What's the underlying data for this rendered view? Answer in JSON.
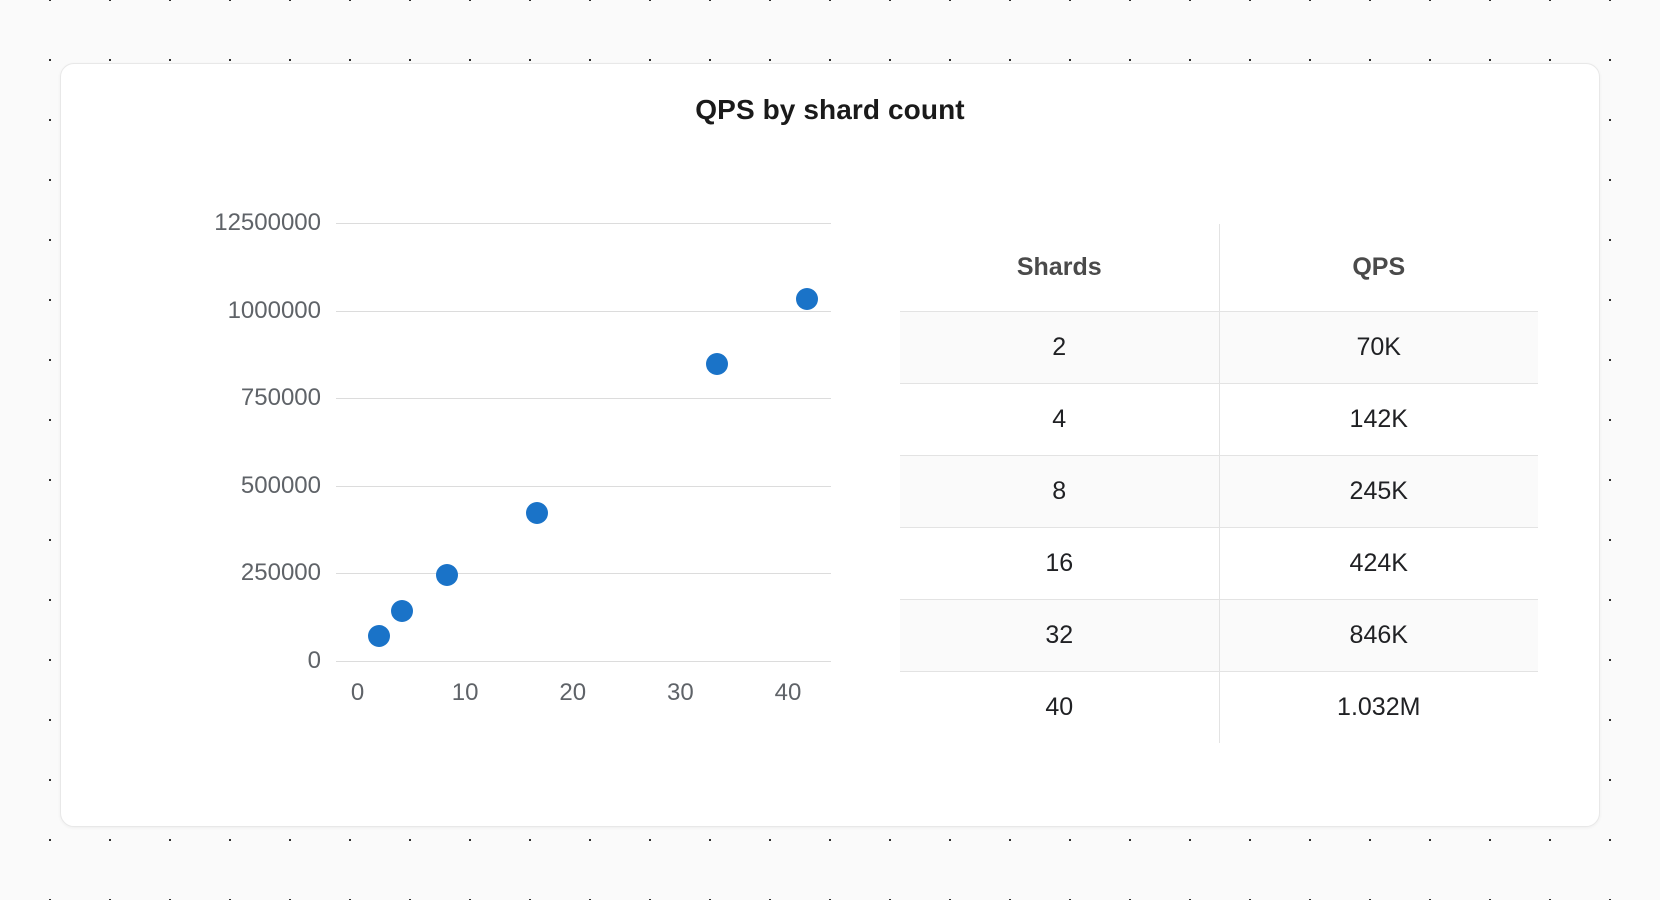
{
  "card": {
    "title": "QPS by shard count"
  },
  "chart_data": {
    "type": "scatter",
    "title": "QPS by shard count",
    "xlabel": "",
    "ylabel": "",
    "x": [
      2,
      4,
      8,
      16,
      32,
      40
    ],
    "y": [
      70000,
      142000,
      245000,
      424000,
      846000,
      1032000
    ],
    "series": [
      {
        "name": "QPS",
        "values": [
          70000,
          142000,
          245000,
          424000,
          846000,
          1032000
        ]
      }
    ],
    "point_color": "#1a73c8",
    "grid": true,
    "legend": "none",
    "xlim": [
      -2,
      44
    ],
    "ylim": [
      0,
      1250000
    ],
    "xticks": [
      "0",
      "10",
      "20",
      "30",
      "40"
    ],
    "xtick_values": [
      0,
      10,
      20,
      30,
      40
    ],
    "yticks": [
      "12500000",
      "1000000",
      "750000",
      "500000",
      "250000",
      "0"
    ],
    "ytick_values": [
      1250000,
      1000000,
      750000,
      500000,
      250000,
      0
    ],
    "points": [
      {
        "x": 2,
        "y": 70000,
        "left_pct": 8.7,
        "top_pct": 94.4
      },
      {
        "x": 4,
        "y": 142000,
        "left_pct": 13.3,
        "top_pct": 88.6
      },
      {
        "x": 8,
        "y": 245000,
        "left_pct": 22.4,
        "top_pct": 80.4
      },
      {
        "x": 16,
        "y": 424000,
        "left_pct": 40.6,
        "top_pct": 66.1
      },
      {
        "x": 32,
        "y": 846000,
        "left_pct": 77.0,
        "top_pct": 32.3
      },
      {
        "x": 40,
        "y": 1032000,
        "left_pct": 95.2,
        "top_pct": 17.4
      }
    ],
    "gridline_positions_pct": [
      0,
      20,
      40,
      60,
      80,
      100
    ]
  },
  "table": {
    "columns": [
      "Shards",
      "QPS"
    ],
    "rows": [
      {
        "shards": "2",
        "qps": "70K"
      },
      {
        "shards": "4",
        "qps": "142K"
      },
      {
        "shards": "8",
        "qps": "245K"
      },
      {
        "shards": "16",
        "qps": "424K"
      },
      {
        "shards": "32",
        "qps": "846K"
      },
      {
        "shards": "40",
        "qps": "1.032M"
      }
    ]
  },
  "colors": {
    "accent": "#1a73c8",
    "background": "#fafafa",
    "card": "#ffffff",
    "gridline": "#dcdcdc",
    "tick_text": "#5f6368",
    "title_text": "#1a1a1a"
  }
}
